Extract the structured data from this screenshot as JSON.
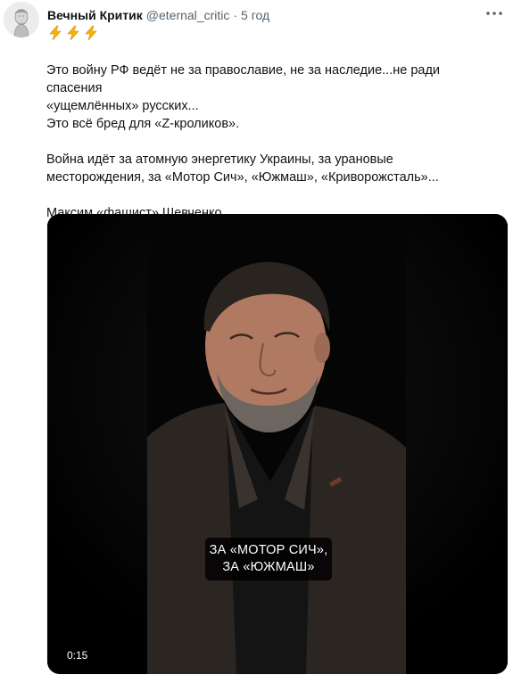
{
  "tweet": {
    "author_name": "Вечный Критик",
    "author_handle": "@eternal_critic",
    "separator": "·",
    "time": "5 год",
    "emoji": [
      "⚡",
      "⚡",
      "⚡"
    ],
    "lines": [
      "Это войну РФ ведёт не за православие, не за наследие...не ради спасения",
      "«ущемлённых» русских...",
      "Это всё бред для «Z-кроликов».",
      "",
      "Война идёт за атомную энергетику Украины, за урановые",
      "месторождения, за «Мотор Сич», «Южмаш», «Криворожсталь»...",
      "",
      "Максим «фашист» Шевченко."
    ]
  },
  "video": {
    "subtitle_line1": "ЗА «МОТОР СИЧ»,",
    "subtitle_line2": "ЗА «ЮЖМАШ»",
    "duration": "0:15"
  },
  "colors": {
    "text": "#0f1419",
    "secondary": "#536471",
    "video_bg": "#000000",
    "lightning": "#f4b400"
  },
  "icons": {
    "more": "more-horizontal-icon",
    "lightning": "high-voltage-icon"
  }
}
